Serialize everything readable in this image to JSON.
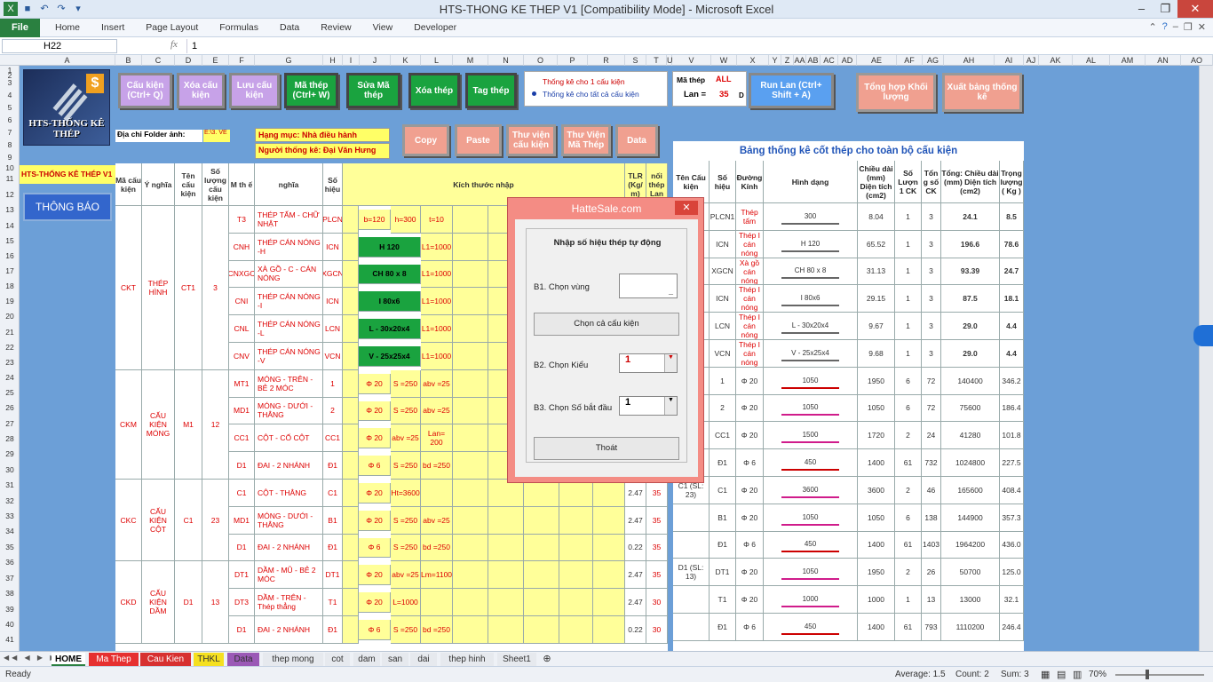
{
  "window": {
    "title": "HTS-THONG KE THEP V1  [Compatibility Mode]  -  Microsoft Excel",
    "controls": [
      "?",
      "–",
      "❐",
      "✕"
    ]
  },
  "ribbon": {
    "file": "File",
    "tabs": [
      "Home",
      "Insert",
      "Page Layout",
      "Formulas",
      "Data",
      "Review",
      "View",
      "Developer"
    ]
  },
  "formula": {
    "name_box": "H22",
    "fx": "fx",
    "value": "1"
  },
  "columns": [
    "A",
    "B",
    "C",
    "D",
    "E",
    "F",
    "G",
    "H",
    "I",
    "J",
    "K",
    "L",
    "M",
    "N",
    "O",
    "P",
    "R",
    "S",
    "T",
    "U",
    "V",
    "W",
    "X",
    "Y",
    "Z",
    "AA",
    "AB",
    "AC",
    "AD",
    "AE",
    "AF",
    "AG",
    "AH",
    "AI",
    "AJ",
    "AK",
    "AL",
    "AM",
    "AN",
    "AO"
  ],
  "rows": [
    "1",
    "2",
    "3",
    "4",
    "5",
    "6",
    "7",
    "8",
    "9",
    "10",
    "11",
    "12",
    "13",
    "14",
    "15",
    "16",
    "17",
    "18",
    "19",
    "20",
    "21",
    "22",
    "23",
    "24",
    "25",
    "26",
    "27",
    "28",
    "29",
    "30",
    "31",
    "32",
    "33",
    "34",
    "35",
    "36",
    "37",
    "38",
    "39",
    "40",
    "41",
    "42"
  ],
  "logo": {
    "title": "HTS-THỐNG KÊ THÉP",
    "symbol": "$"
  },
  "buttons": {
    "cau_kien": "Cấu kiện (Ctrl+ Q)",
    "xoa_ck": "Xóa cấu kiện",
    "luu_ck": "Lưu cấu kiện",
    "ma_thep": "Mã thép (Ctrl+ W)",
    "sua_ma": "Sửa Mã thép",
    "xoa_thep": "Xóa thép",
    "tag_thep": "Tag thép",
    "run_lan": "Run Lan (Ctrl+ Shift + A)",
    "tong_hop": "Tổng hợp Khối lượng",
    "xuat_bang": "Xuất bảng thống kê",
    "copy": "Copy",
    "paste": "Paste",
    "tv_ck": "Thư viện cấu kiện",
    "tv_ma": "Thư Viện Mã Thép",
    "data": "Data"
  },
  "radio": {
    "one": "Thống kê cho 1 cấu kiện",
    "all": "Thống kê cho tất cả cấu kiện"
  },
  "mathep": {
    "label": "Mã thép",
    "value": "ALL",
    "lan_label": "Lan =",
    "lan_value": "35",
    "d": "D"
  },
  "folder": {
    "label": "Địa chỉ Folder ảnh:",
    "value": "E:\\3. VE"
  },
  "hangmuc": {
    "hm": "Hạng mục: Nhà điều hành",
    "ntk": "Người thống kê: Đại Văn Hưng"
  },
  "hts_label": "HTS-THỐNG KÊ THÉP V1",
  "notice": "THÔNG BÁO",
  "left_headers": [
    "Mã cấu kiện",
    "Ý nghĩa",
    "Tên cấu kiện",
    "Số lượng cấu kiện",
    "M th ế",
    "nghĩa",
    "Số hiệu",
    "Kích thước nhập",
    "TLR (Kg/ m)",
    "nối thép Lan"
  ],
  "right_title": "Bảng thống kê cốt thép cho toàn bộ cấu kiện",
  "right_headers": [
    "Tên Cấu kiện",
    "Số hiệu",
    "Đường Kính",
    "Hình dạng",
    "Chiều dài (mm) Diện tích (cm2)",
    "Số Lượn 1 CK",
    "Tổn g số CK",
    "Tổng: Chiều dài (mm) Diện tích (cm2)",
    "Trọng lượng ( Kg )"
  ],
  "groups": [
    {
      "code": "CKT",
      "meaning": "THÉP HÌNH",
      "name": "CT1",
      "qty": "3"
    },
    {
      "code": "CKM",
      "meaning": "CẤU KIỆN MÓNG",
      "name": "M1",
      "qty": "12"
    },
    {
      "code": "CKC",
      "meaning": "CẤU KIỆN CỘT",
      "name": "C1",
      "qty": "23"
    },
    {
      "code": "CKD",
      "meaning": "CẤU KIỆN DẦM",
      "name": "D1",
      "qty": "13"
    }
  ],
  "left_rows": [
    {
      "m": "T3",
      "desc": "THÉP TẤM - CHỮ NHẬT",
      "sh": "PLCN",
      "k1": "b=120",
      "k2": "h=300",
      "k3": "t=10",
      "tlr": "",
      "lan": ""
    },
    {
      "m": "CNH",
      "desc": "THÉP CÁN NÓNG -H",
      "sh": "ICN",
      "k1": "H 120",
      "k2": "",
      "k3": "L1=1000",
      "tlr": "",
      "lan": ""
    },
    {
      "m": "CNXGC",
      "desc": "XÀ GỒ - C - CÁN NÓNG",
      "sh": "XGCN",
      "k1": "CH 80 x 8",
      "k2": "",
      "k3": "L1=1000",
      "tlr": "",
      "lan": ""
    },
    {
      "m": "CNI",
      "desc": "THÉP CÁN NÓNG -I",
      "sh": "ICN",
      "k1": "I 80x6",
      "k2": "",
      "k3": "L1=1000",
      "tlr": "",
      "lan": ""
    },
    {
      "m": "CNL",
      "desc": "THÉP CÁN NÓNG -L",
      "sh": "LCN",
      "k1": "L - 30x20x4",
      "k2": "",
      "k3": "L1=1000",
      "tlr": "",
      "lan": ""
    },
    {
      "m": "CNV",
      "desc": "THÉP CÁN NÓNG -V",
      "sh": "VCN",
      "k1": "V - 25x25x4",
      "k2": "",
      "k3": "L1=1000",
      "tlr": "",
      "lan": ""
    },
    {
      "m": "MT1",
      "desc": "MÓNG - TRÊN - BẺ 2 MÓC",
      "sh": "1",
      "k1": "Φ 20",
      "k2": "S =250",
      "k3": "abv =25",
      "tlr": "",
      "lan": ""
    },
    {
      "m": "MD1",
      "desc": "MÓNG - DƯỚI - THẲNG",
      "sh": "2",
      "k1": "Φ 20",
      "k2": "S =250",
      "k3": "abv =25",
      "tlr": "",
      "lan": ""
    },
    {
      "m": "CC1",
      "desc": "CỘT - CỐ CỘT",
      "sh": "CC1",
      "k1": "Φ 20",
      "k2": "abv =25",
      "k3": "Lan= 200",
      "tlr": "",
      "lan": ""
    },
    {
      "m": "D1",
      "desc": "ĐAI - 2 NHÁNH",
      "sh": "Đ1",
      "k1": "Φ 6",
      "k2": "S =250",
      "k3": "bd =250",
      "tlr": "",
      "lan": ""
    },
    {
      "m": "C1",
      "desc": "CỘT - THẲNG",
      "sh": "C1",
      "k1": "Φ 20",
      "k2": "Ht=3600",
      "k3": "",
      "tlr": "2.47",
      "lan": "35"
    },
    {
      "m": "MD1",
      "desc": "MÓNG - DƯỚI - THẲNG",
      "sh": "B1",
      "k1": "Φ 20",
      "k2": "S =250",
      "k3": "abv =25",
      "tlr": "2.47",
      "lan": "35"
    },
    {
      "m": "D1",
      "desc": "ĐAI - 2 NHÁNH",
      "sh": "Đ1",
      "k1": "Φ 6",
      "k2": "S =250",
      "k3": "bd =250",
      "tlr": "0.22",
      "lan": "35"
    },
    {
      "m": "DT1",
      "desc": "DẦM - MŨ - BẺ 2 MÓC",
      "sh": "DT1",
      "k1": "Φ 20",
      "k2": "abv =25",
      "k3": "Lm=1100",
      "tlr": "2.47",
      "lan": "35"
    },
    {
      "m": "DT3",
      "desc": "DẦM - TRÊN - Thép thẳng",
      "sh": "T1",
      "k1": "Φ 20",
      "k2": "L=1000",
      "k3": "",
      "tlr": "2.47",
      "lan": "30"
    },
    {
      "m": "D1",
      "desc": "ĐAI - 2 NHÁNH",
      "sh": "Đ1",
      "k1": "Φ 6",
      "k2": "S =250",
      "k3": "bd =250",
      "tlr": "0.22",
      "lan": "30"
    }
  ],
  "right_rows": [
    {
      "name": "",
      "sh": "PLCN1",
      "dk": "Thép tấm",
      "shape": "300",
      "len": "8.04",
      "n1": "1",
      "nt": "3",
      "tot": "24.1",
      "w": "8.5"
    },
    {
      "name": "",
      "sh": "ICN",
      "dk": "Thép I cán nóng",
      "shape": "H 120",
      "len": "65.52",
      "n1": "1",
      "nt": "3",
      "tot": "196.6",
      "w": "78.6"
    },
    {
      "name": "",
      "sh": "XGCN",
      "dk": "Xà gồ cán nóng",
      "shape": "CH 80 x 8",
      "len": "31.13",
      "n1": "1",
      "nt": "3",
      "tot": "93.39",
      "w": "24.7"
    },
    {
      "name": "",
      "sh": "ICN",
      "dk": "Thép I cán nóng",
      "shape": "I 80x6",
      "len": "29.15",
      "n1": "1",
      "nt": "3",
      "tot": "87.5",
      "w": "18.1"
    },
    {
      "name": "",
      "sh": "LCN",
      "dk": "Thép I cán nóng",
      "shape": "L - 30x20x4",
      "len": "9.67",
      "n1": "1",
      "nt": "3",
      "tot": "29.0",
      "w": "4.4"
    },
    {
      "name": "",
      "sh": "VCN",
      "dk": "Thép I cán nóng",
      "shape": "V - 25x25x4",
      "len": "9.68",
      "n1": "1",
      "nt": "3",
      "tot": "29.0",
      "w": "4.4"
    },
    {
      "name": "",
      "sh": "1",
      "dk": "Φ 20",
      "shape": "1050",
      "len": "1950",
      "n1": "6",
      "nt": "72",
      "tot": "140400",
      "w": "346.2"
    },
    {
      "name": "",
      "sh": "2",
      "dk": "Φ 20",
      "shape": "1050",
      "len": "1050",
      "n1": "6",
      "nt": "72",
      "tot": "75600",
      "w": "186.4"
    },
    {
      "name": "",
      "sh": "CC1",
      "dk": "Φ 20",
      "shape": "1500",
      "len": "1720",
      "n1": "2",
      "nt": "24",
      "tot": "41280",
      "w": "101.8"
    },
    {
      "name": "",
      "sh": "Đ1",
      "dk": "Φ 6",
      "shape": "450",
      "len": "1400",
      "n1": "61",
      "nt": "732",
      "tot": "1024800",
      "w": "227.5"
    },
    {
      "name": "C1 (SL: 23)",
      "sh": "C1",
      "dk": "Φ 20",
      "shape": "3600",
      "len": "3600",
      "n1": "2",
      "nt": "46",
      "tot": "165600",
      "w": "408.4"
    },
    {
      "name": "",
      "sh": "B1",
      "dk": "Φ 20",
      "shape": "1050",
      "len": "1050",
      "n1": "6",
      "nt": "138",
      "tot": "144900",
      "w": "357.3"
    },
    {
      "name": "",
      "sh": "Đ1",
      "dk": "Φ 6",
      "shape": "450",
      "len": "1400",
      "n1": "61",
      "nt": "1403",
      "tot": "1964200",
      "w": "436.0"
    },
    {
      "name": "D1 (SL: 13)",
      "sh": "DT1",
      "dk": "Φ 20",
      "shape": "1050",
      "len": "1950",
      "n1": "2",
      "nt": "26",
      "tot": "50700",
      "w": "125.0"
    },
    {
      "name": "",
      "sh": "T1",
      "dk": "Φ 20",
      "shape": "1000",
      "len": "1000",
      "n1": "1",
      "nt": "13",
      "tot": "13000",
      "w": "32.1"
    },
    {
      "name": "",
      "sh": "Đ1",
      "dk": "Φ 6",
      "shape": "450",
      "len": "1400",
      "n1": "61",
      "nt": "793",
      "tot": "1110200",
      "w": "246.4"
    }
  ],
  "dialog": {
    "title": "HatteSale.com",
    "close": "✕",
    "heading": "Nhập số hiệu thép tự động",
    "b1": "B1. Chọn vùng",
    "chon_ca": "Chọn cả cấu kiện",
    "b2": "B2. Chọn Kiểu",
    "b2_value": "1",
    "b3": "B3. Chọn Số bắt đầu",
    "b3_value": "1",
    "exit": "Thoát"
  },
  "sheet_tabs": [
    "HOME",
    "Ma Thep",
    "Cau Kien",
    "THKL",
    "Data",
    "thep mong",
    "cot",
    "dam",
    "san",
    "dai",
    "thep hinh",
    "Sheet1"
  ],
  "status": {
    "ready": "Ready",
    "average": "Average: 1.5",
    "count": "Count: 2",
    "sum": "Sum: 3",
    "zoom": "70%"
  }
}
